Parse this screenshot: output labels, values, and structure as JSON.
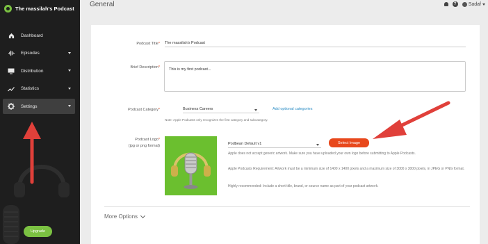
{
  "brand": {
    "name": "The massilah's Podcast"
  },
  "sidebar": {
    "items": [
      {
        "label": "Dashboard",
        "icon": "home-icon",
        "has_caret": false
      },
      {
        "label": "Episodes",
        "icon": "waveform-icon",
        "has_caret": true
      },
      {
        "label": "Distribution",
        "icon": "monitor-icon",
        "has_caret": true
      },
      {
        "label": "Statistics",
        "icon": "trend-icon",
        "has_caret": true
      },
      {
        "label": "Settings",
        "icon": "gear-icon",
        "has_caret": true,
        "active": true
      }
    ],
    "upgrade_label": "Upgrade"
  },
  "header": {
    "title": "General",
    "user_name": "Sadaf",
    "help_glyph": "?"
  },
  "form": {
    "title_label": "Podcast Title",
    "title_value": "The massilah's Podcast",
    "description_label": "Brief Description",
    "description_value": "This is my first podcast...",
    "category_label": "Podcast Category",
    "category_value": "Business Careers",
    "add_categories_link": "Add optional categories",
    "category_note": "Note: Apple Podcasts only recognizes the first category and subcategory.",
    "logo_label": "Podcast Logo",
    "logo_format": "(jpg or png format)",
    "logo_template_value": "Podbean Default v1",
    "select_image_label": "Select Image",
    "logo_help_1": "Apple does not accept generic artwork. Make sure you have uploaded your own logo before submitting to Apple Podcasts.",
    "logo_help_2": "Apple Podcasts Requirement: Artwork must be a minimum size of 1400 x 1400 pixels and a maximum size of 3000 x 3000 pixels, in JPEG or PNG format.",
    "logo_help_3": "Highly recommended: Include a short title, brand, or source name as part of your podcast artwork.",
    "more_options": "More Options"
  },
  "colors": {
    "brand_green": "#7bc142",
    "accent_orange": "#e8481c",
    "annotation_red": "#e0403a",
    "sidebar_bg": "#1e1e1e"
  }
}
